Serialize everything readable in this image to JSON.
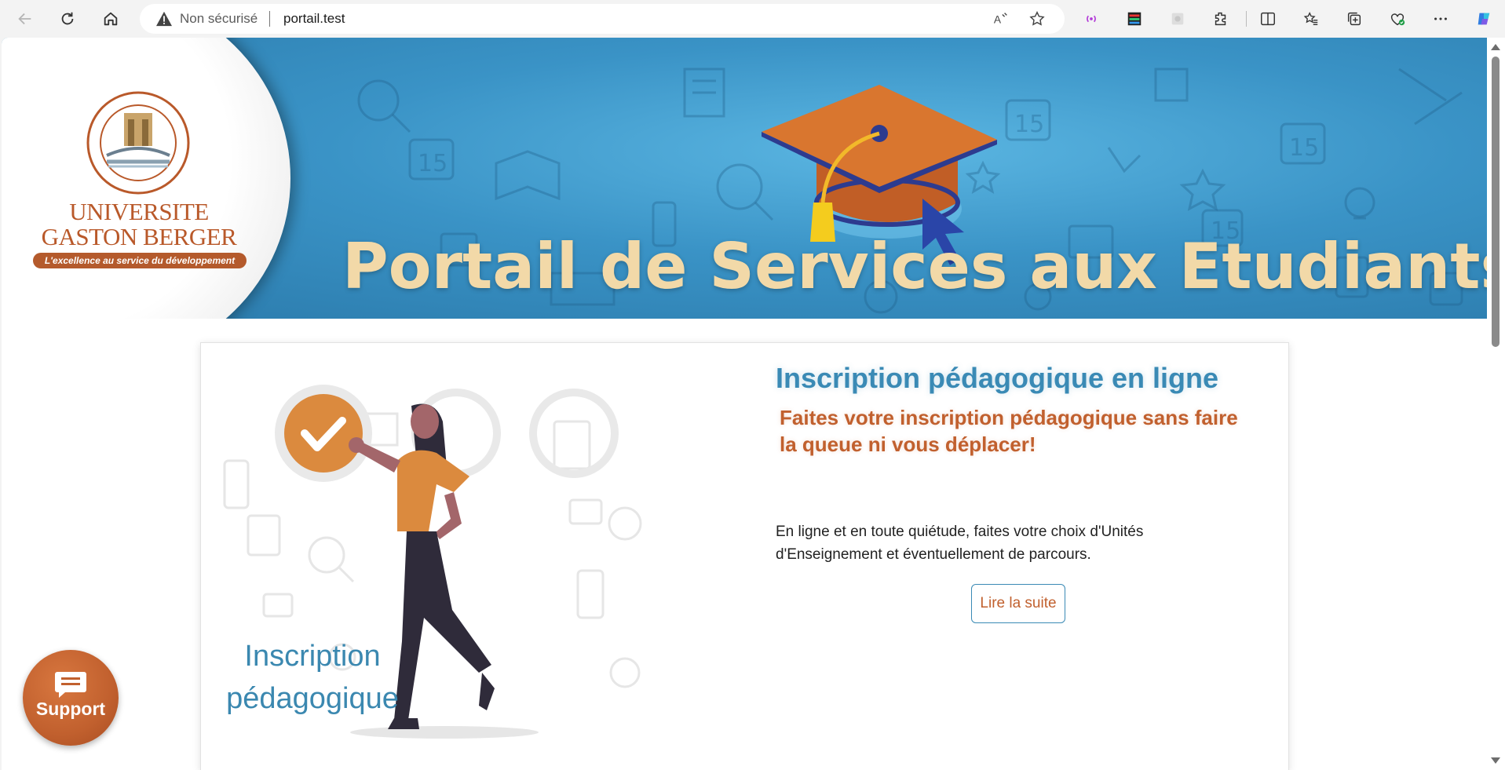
{
  "browser": {
    "security_label": "Non sécurisé",
    "url": "portail.test"
  },
  "banner": {
    "logo_line1": "UNIVERSITE",
    "logo_line2": "GASTON BERGER",
    "logo_tagline": "L'excellence au service du développement",
    "title": "Portail de Services aux Etudiants"
  },
  "card": {
    "illustration_label_line1": "Inscription",
    "illustration_label_line2": "pédagogique",
    "title": "Inscription pédagogique en ligne",
    "subtitle_line1": "Faites votre inscription pédagogique sans faire",
    "subtitle_line2": "la queue ni vous déplacer!",
    "description_line1": "En ligne et en toute quiétude, faites votre choix d'Unités",
    "description_line2": "d'Enseignement et éventuellement de parcours.",
    "button_label": "Lire la suite"
  },
  "support": {
    "label": "Support"
  },
  "colors": {
    "banner_blue": "#3a93c6",
    "accent_orange": "#c1602e",
    "title_blue": "#3a8ab5",
    "banner_text": "#f2d9a8"
  }
}
